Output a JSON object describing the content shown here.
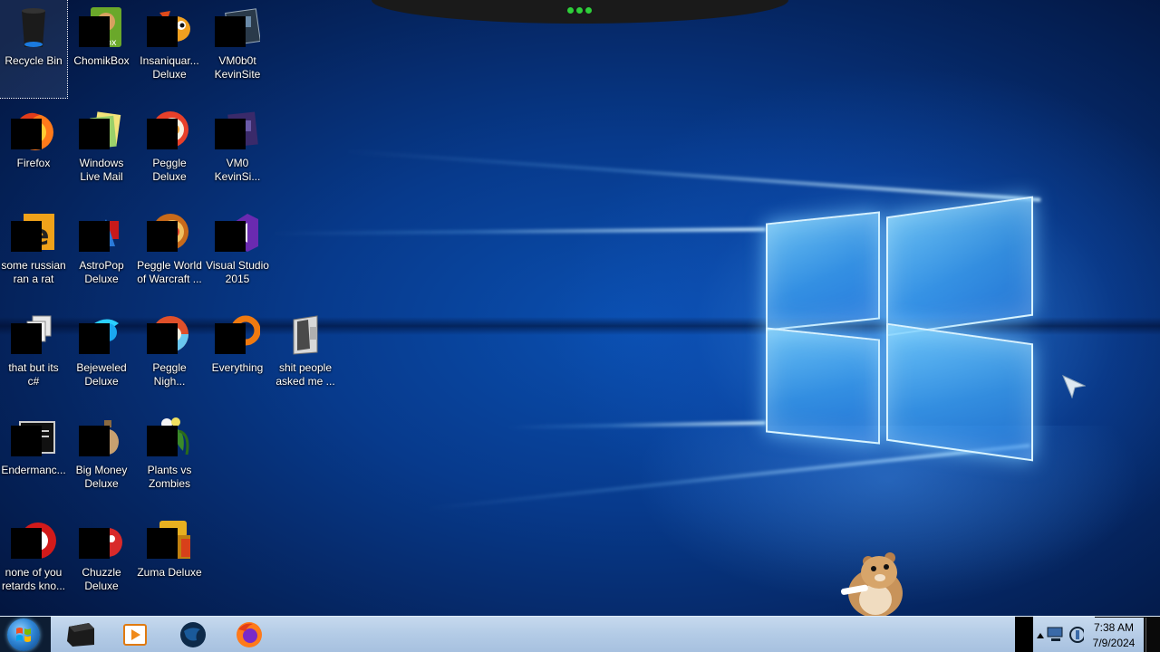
{
  "desktop": {
    "icons": [
      {
        "label": "Recycle Bin",
        "icon": "recycle-bin-icon"
      },
      {
        "label": "ChomikBox",
        "icon": "chomikbox-icon"
      },
      {
        "label": "Insaniquar...\nDeluxe",
        "icon": "insaniquarium-icon"
      },
      {
        "label": "VM0b0t\nKevinSite",
        "icon": "vm0b0t-icon"
      },
      {
        "label": "Firefox",
        "icon": "firefox-icon"
      },
      {
        "label": "Windows\nLive Mail",
        "icon": "windows-live-mail-icon"
      },
      {
        "label": "Peggle\nDeluxe",
        "icon": "peggle-icon"
      },
      {
        "label": "VM0\nKevinSi...",
        "icon": "vm0-icon"
      },
      {
        "label": "some russian\nran a rat",
        "icon": "russian-rat-icon"
      },
      {
        "label": "AstroPop\nDeluxe",
        "icon": "astropop-icon"
      },
      {
        "label": "Peggle World\nof Warcraft ...",
        "icon": "peggle-wow-icon"
      },
      {
        "label": "Visual Studio\n2015",
        "icon": "visual-studio-icon"
      },
      {
        "label": "that but its\nc#",
        "icon": "copies-icon"
      },
      {
        "label": "Bejeweled\nDeluxe",
        "icon": "bejeweled-icon"
      },
      {
        "label": "Peggle\nNigh...",
        "icon": "peggle-nights-icon"
      },
      {
        "label": "Everything",
        "icon": "everything-search-icon"
      },
      {
        "label": "shit people\nasked me ...",
        "icon": "folder-icon"
      },
      {
        "label": "Endermanc...",
        "icon": "terminal-icon"
      },
      {
        "label": "Big Money\nDeluxe",
        "icon": "big-money-icon"
      },
      {
        "label": "Plants vs\nZombies",
        "icon": "plants-vs-zombies-icon"
      },
      {
        "label": "none of you\nretards kno...",
        "icon": "red-circle-icon"
      },
      {
        "label": "Chuzzle\nDeluxe",
        "icon": "chuzzle-icon"
      },
      {
        "label": "Zuma Deluxe",
        "icon": "zuma-icon"
      }
    ]
  },
  "taskbar": {
    "pinned": [
      {
        "name": "taskbar-terminal",
        "icon": "terminal-icon"
      },
      {
        "name": "taskbar-media-player",
        "icon": "media-player-icon"
      },
      {
        "name": "taskbar-browser-globe",
        "icon": "globe-icon"
      },
      {
        "name": "taskbar-firefox",
        "icon": "firefox-icon"
      }
    ],
    "clock": {
      "time": "7:38 AM",
      "date": "7/9/2024"
    }
  },
  "colors": {
    "taskbar": "#b3cbe6",
    "wallpaper_dark": "#05245e",
    "wallpaper_glow": "#46a0ff"
  }
}
